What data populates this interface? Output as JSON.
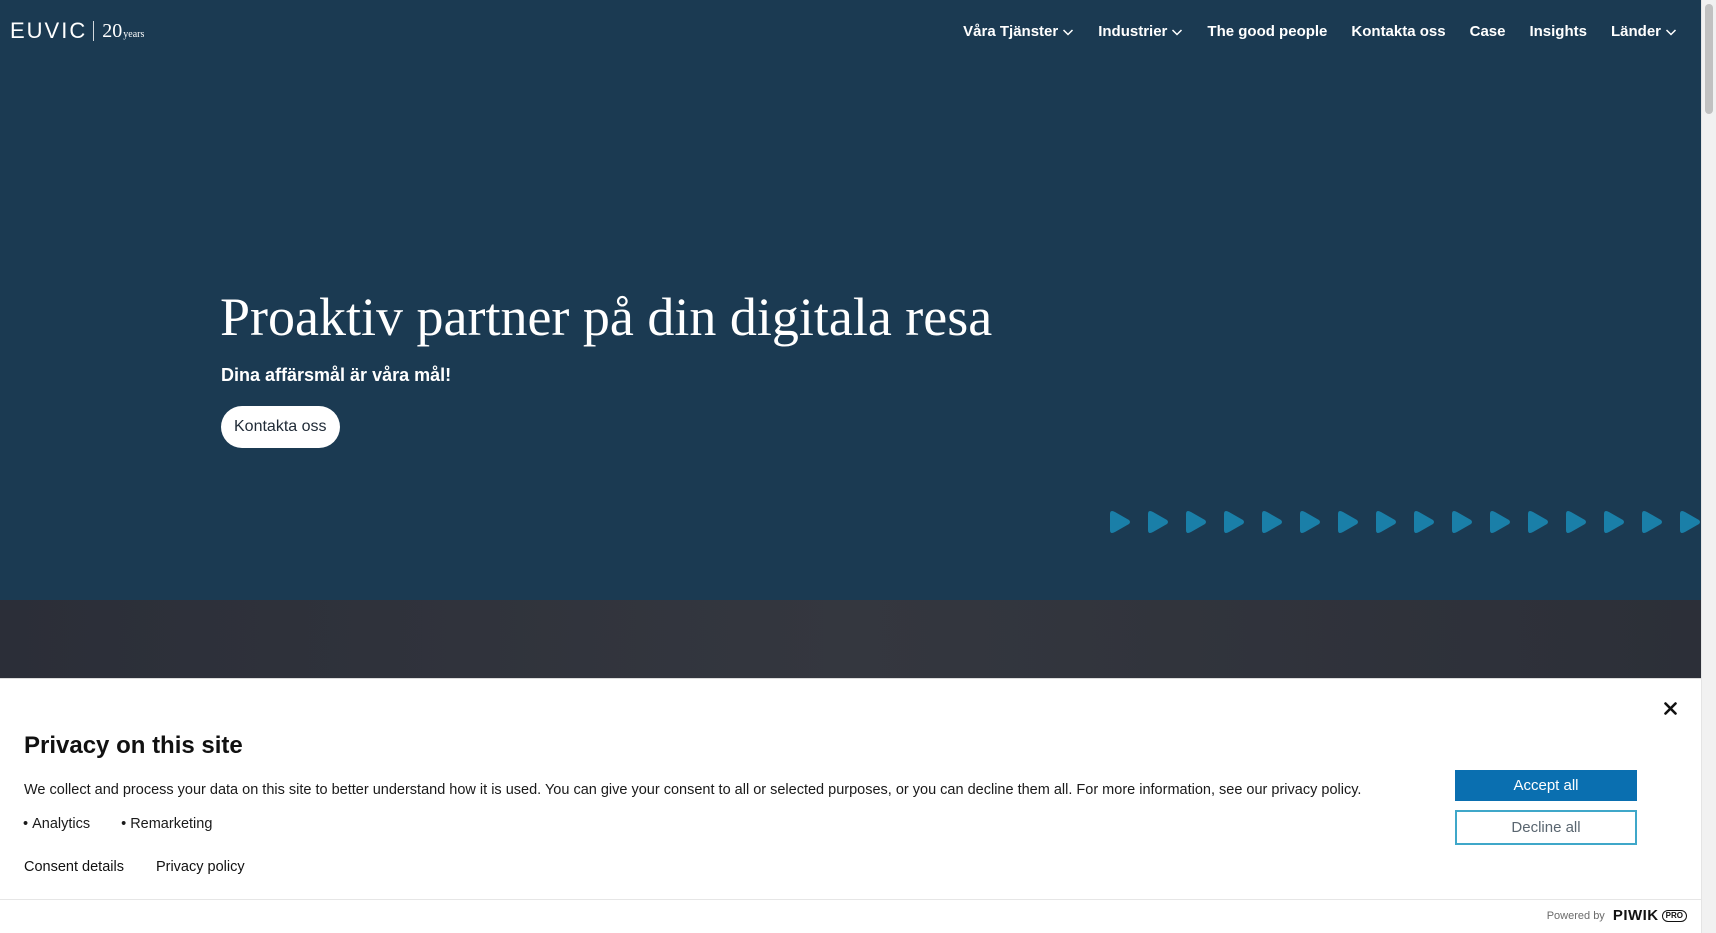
{
  "header": {
    "logo": {
      "brand": "EUVIC",
      "years_number": "20",
      "years_word": "years"
    },
    "nav": [
      {
        "label": "Våra Tjänster",
        "has_dropdown": true
      },
      {
        "label": "Industrier",
        "has_dropdown": true
      },
      {
        "label": "The good people",
        "has_dropdown": false
      },
      {
        "label": "Kontakta oss",
        "has_dropdown": false
      },
      {
        "label": "Case",
        "has_dropdown": false
      },
      {
        "label": "Insights",
        "has_dropdown": false
      },
      {
        "label": "Länder",
        "has_dropdown": true
      }
    ]
  },
  "hero": {
    "title": "Proaktiv partner på din digitala resa",
    "subtitle": "Dina affärsmål är våra mål!",
    "cta_label": "Kontakta oss",
    "arrow_count": 16
  },
  "privacy": {
    "title": "Privacy on this site",
    "description": "We collect and process your data on this site to better understand how it is used. You can give your consent to all or selected purposes, or you can decline them all. For more information, see our privacy policy.",
    "purposes": [
      "Analytics",
      "Remarketing"
    ],
    "links": {
      "consent_details": "Consent details",
      "privacy_policy": "Privacy policy"
    },
    "accept_label": "Accept all",
    "decline_label": "Decline all",
    "powered_by": "Powered by",
    "vendor_name": "PIWIK",
    "vendor_badge": "PRO"
  },
  "colors": {
    "hero_bg": "#1b3a52",
    "band_bg": "#2e3139",
    "arrow": "#1a7fa8",
    "accept_bg": "#0a6fb0",
    "decline_border": "#3fa7c9"
  }
}
